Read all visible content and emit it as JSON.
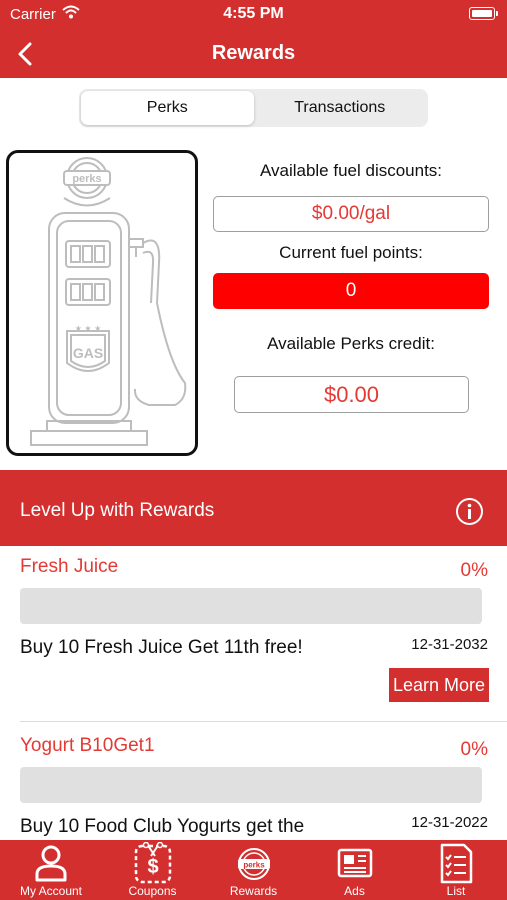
{
  "status_bar": {
    "carrier": "Carrier",
    "time": "4:55 PM"
  },
  "nav": {
    "title": "Rewards"
  },
  "segment": {
    "perks": "Perks",
    "transactions": "Transactions"
  },
  "pump": {
    "badge": "perks",
    "sign": "GAS"
  },
  "perks": {
    "fuel_discount_label": "Available fuel discounts:",
    "fuel_discount_value": "$0.00/gal",
    "fuel_points_label": "Current fuel points:",
    "fuel_points_value": "0",
    "credit_label": "Available Perks credit:",
    "credit_value": "$0.00"
  },
  "level_up": {
    "label": "Level Up with Rewards"
  },
  "rewards": [
    {
      "name": "Fresh Juice",
      "percent": "0%",
      "progress": 0,
      "description": "Buy 10 Fresh Juice Get 11th free!",
      "date": "12-31-2032",
      "learn_more": "Learn More"
    },
    {
      "name": "Yogurt B10Get1",
      "percent": "0%",
      "progress": 0,
      "description": "Buy 10 Food Club Yogurts get the",
      "date": "12-31-2022"
    }
  ],
  "tabs": [
    {
      "label": "My Account",
      "icon": "user-icon"
    },
    {
      "label": "Coupons",
      "icon": "coupon-icon"
    },
    {
      "label": "Rewards",
      "icon": "perks-icon"
    },
    {
      "label": "Ads",
      "icon": "ads-icon"
    },
    {
      "label": "List",
      "icon": "list-icon"
    }
  ],
  "colors": {
    "brand_red": "#d32f2f",
    "points_red": "#ff0000",
    "text_red": "#e53935"
  }
}
